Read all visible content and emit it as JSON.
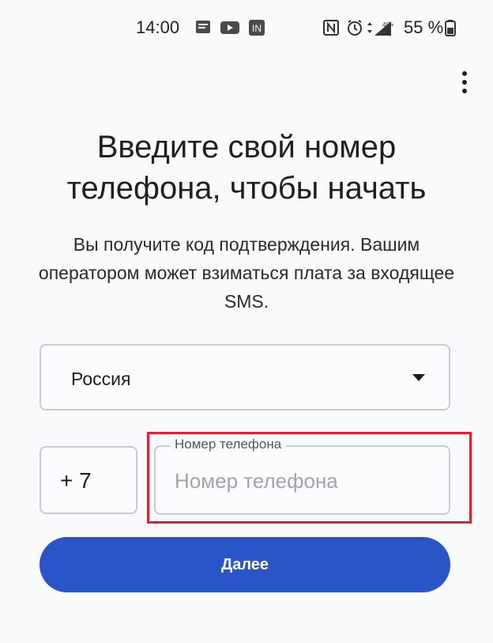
{
  "status_bar": {
    "time": "14:00",
    "left_icons": [
      "message-icon",
      "youtube-icon",
      "linkedin-icon"
    ],
    "right_icons": [
      "nfc-icon",
      "alarm-icon",
      "signal-4g-icon",
      "battery-icon"
    ],
    "battery_percent_text": "55 %",
    "network_label": "4G+"
  },
  "menu": {
    "icon": "more-vert-icon"
  },
  "heading": {
    "title": "Введите свой номер телефона, чтобы начать",
    "subtitle": "Вы получите код подтверждения. Вашим оператором может взиматься плата за входящее SMS."
  },
  "form": {
    "country": {
      "selected": "Россия",
      "icon": "dropdown-arrow-icon"
    },
    "dial_code": "+ 7",
    "phone": {
      "label": "Номер телефона",
      "placeholder": "Номер телефона",
      "value": ""
    },
    "next_label": "Далее"
  },
  "colors": {
    "primary": "#2a55c8",
    "highlight": "#d7243a",
    "background": "#f9fafc",
    "outline": "#c9cbd0"
  }
}
